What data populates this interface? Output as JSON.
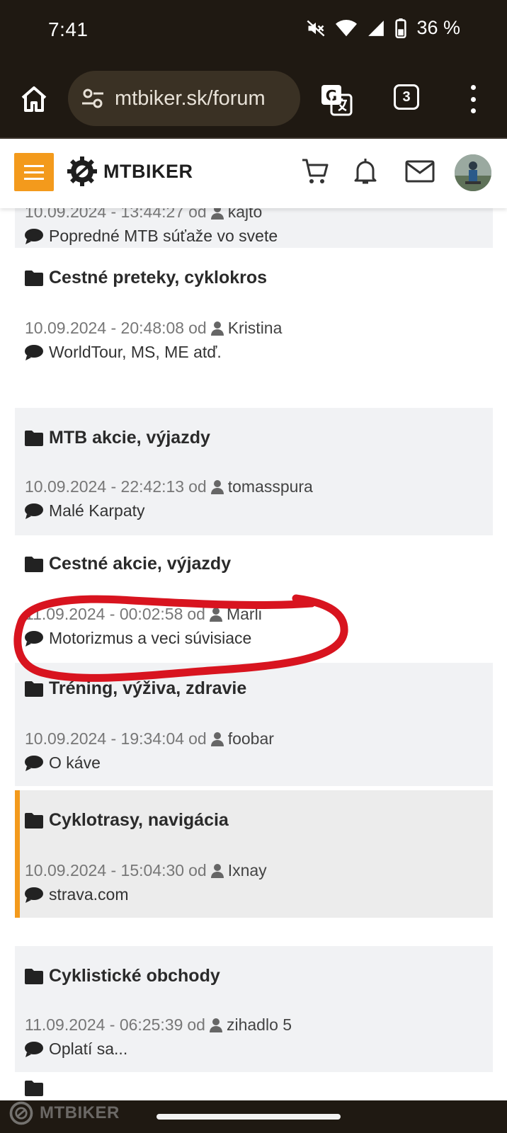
{
  "status_bar": {
    "time": "7:41",
    "battery": "36 %"
  },
  "browser": {
    "url": "mtbiker.sk/forum",
    "tab_count": "3"
  },
  "site": {
    "logo_text": "MTBIKER",
    "accent_color": "#f39a1c"
  },
  "forum_rows": [
    {
      "title": "",
      "date": "10.09.2024 - 13:44:27",
      "od": "od",
      "user": "kajto",
      "last_topic": "Popredné MTB súťaže vo svete"
    },
    {
      "title": "Cestné preteky, cyklokros",
      "date": "10.09.2024 - 20:48:08",
      "od": "od",
      "user": "Kristina",
      "last_topic": "WorldTour, MS, ME atď."
    },
    {
      "title": "MTB akcie, výjazdy",
      "date": "10.09.2024 - 22:42:13",
      "od": "od",
      "user": "tomasspura",
      "last_topic": "Malé Karpaty"
    },
    {
      "title": "Cestné akcie, výjazdy",
      "date": "11.09.2024 - 00:02:58",
      "od": "od",
      "user": "Marli",
      "last_topic": "Motorizmus a veci súvisiace"
    },
    {
      "title": "Tréning, výživa, zdravie",
      "date": "10.09.2024 - 19:34:04",
      "od": "od",
      "user": "foobar",
      "last_topic": "O káve"
    },
    {
      "title": "Cyklotrasy, navigácia",
      "date": "10.09.2024 - 15:04:30",
      "od": "od",
      "user": "Ixnay",
      "last_topic": "strava.com"
    },
    {
      "title": "Cyklistické obchody",
      "date": "11.09.2024 - 06:25:39",
      "od": "od",
      "user": "zihadlo 5",
      "last_topic": "Oplatí sa..."
    }
  ],
  "watermark": {
    "text": "MTBIKER"
  },
  "annotation": {
    "color": "#d8141f"
  },
  "icons": [
    "home-icon",
    "tune-icon",
    "translate-icon",
    "tabs-icon",
    "more-icon",
    "menu-icon",
    "cart-icon",
    "bell-icon",
    "mail-icon",
    "folder-icon",
    "user-icon",
    "comment-icon"
  ]
}
